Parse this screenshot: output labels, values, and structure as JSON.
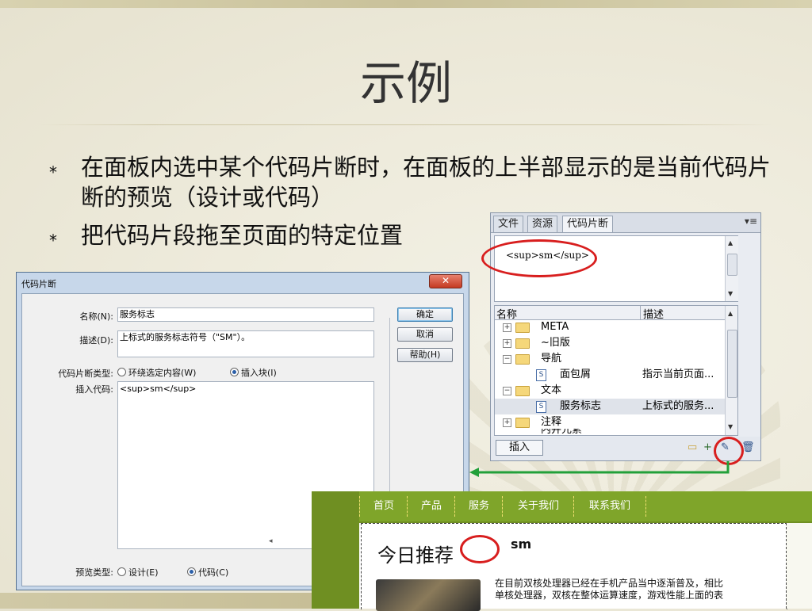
{
  "slide": {
    "title": "示例",
    "bullets": [
      "在面板内选中某个代码片断时，在面板的上半部显示的是当前代码片断的预览（设计或代码）",
      "把代码片段拖至页面的特定位置"
    ],
    "bullet_mark": "⁎"
  },
  "panel": {
    "tabs": [
      "文件",
      "资源",
      "代码片断"
    ],
    "menu_glyph": "▾≡",
    "preview_code": "<sup>sm</sup>",
    "columns": [
      "名称",
      "描述"
    ],
    "rows": [
      {
        "expander": "⊞",
        "name": "META",
        "desc": ""
      },
      {
        "expander": "⊞",
        "name": "~旧版",
        "desc": ""
      },
      {
        "expander": "⊟",
        "name": "导航",
        "desc": ""
      },
      {
        "expander": "",
        "name": "面包屑",
        "desc": "指示当前页面..."
      },
      {
        "expander": "⊟",
        "name": "文本",
        "desc": ""
      },
      {
        "expander": "",
        "name": "服务标志",
        "desc": "上标式的服务..."
      },
      {
        "expander": "⊞",
        "name": "注释",
        "desc": ""
      },
      {
        "expander": "",
        "name": "内并元素",
        "desc": ""
      }
    ],
    "insert_label": "插入"
  },
  "dialog": {
    "title": "代码片断",
    "close_glyph": "✕",
    "name_label": "名称(N):",
    "name_value": "服务标志",
    "desc_label": "描述(D):",
    "desc_value": "上标式的服务标志符号（\"SM\"）。",
    "type_label": "代码片断类型:",
    "type_wrap": "环绕选定内容(W)",
    "type_block": "插入块(I)",
    "insert_label": "插入代码:",
    "insert_value": "<sup>sm</sup>",
    "preview_label": "预览类型:",
    "preview_design": "设计(E)",
    "preview_code": "代码(C)",
    "ok": "确定",
    "cancel": "取消",
    "help": "帮助(H)"
  },
  "web": {
    "nav": [
      "首页",
      "产品",
      "服务",
      "关于我们",
      "联系我们"
    ],
    "heading": "今日推荐",
    "sup": "sm",
    "para_line1": "在目前双核处理器已经在手机产品当中逐渐普及，相比",
    "para_line2": "单核处理器，双核在整体运算速度，游戏性能上面的表"
  },
  "colors": {
    "annotation_red": "#d81e1e",
    "arrow_green": "#22a03a",
    "web_green": "#7fa52a"
  }
}
